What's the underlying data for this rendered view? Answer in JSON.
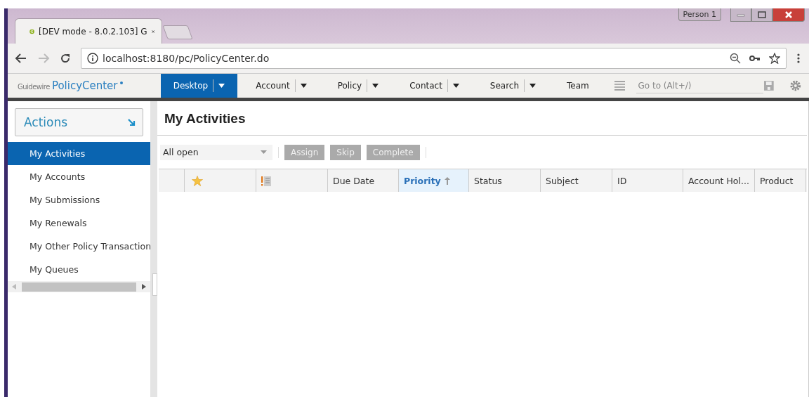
{
  "browser": {
    "tab_title": "[DEV mode - 8.0.2.103] G",
    "url": "localhost:8180/pc/PolicyCenter.do",
    "profile": "Person 1"
  },
  "app_bar": {
    "brand": "Guidewire",
    "product": "PolicyCenter",
    "nav": [
      {
        "label": "Desktop",
        "selected": true,
        "has_menu": true
      },
      {
        "label": "Account",
        "selected": false,
        "has_menu": true
      },
      {
        "label": "Policy",
        "selected": false,
        "has_menu": true
      },
      {
        "label": "Contact",
        "selected": false,
        "has_menu": true
      },
      {
        "label": "Search",
        "selected": false,
        "has_menu": true
      },
      {
        "label": "Team",
        "selected": false,
        "has_menu": false
      }
    ],
    "goto": {
      "placeholder": "Go to (Alt+/)"
    }
  },
  "sidebar": {
    "actions": "Actions",
    "items": [
      {
        "label": "My Activities",
        "selected": true
      },
      {
        "label": "My Accounts",
        "selected": false
      },
      {
        "label": "My Submissions",
        "selected": false
      },
      {
        "label": "My Renewals",
        "selected": false
      },
      {
        "label": "My Other Policy Transaction",
        "selected": false
      },
      {
        "label": "My Queues",
        "selected": false
      }
    ]
  },
  "main": {
    "title": "My Activities",
    "filter": {
      "value": "All open"
    },
    "buttons": [
      {
        "label": "Assign",
        "disabled": true
      },
      {
        "label": "Skip",
        "disabled": true
      },
      {
        "label": "Complete",
        "disabled": true
      }
    ],
    "table": {
      "columns": [
        {
          "kind": "blank",
          "sorted": false
        },
        {
          "kind": "star",
          "sorted": false
        },
        {
          "kind": "flag",
          "sorted": false
        },
        {
          "kind": "text",
          "label": "Due Date",
          "sorted": false
        },
        {
          "kind": "text",
          "label": "Priority",
          "sorted": true
        },
        {
          "kind": "text",
          "label": "Status",
          "sorted": false
        },
        {
          "kind": "text",
          "label": "Subject",
          "sorted": false
        },
        {
          "kind": "text",
          "label": "ID",
          "sorted": false
        },
        {
          "kind": "text",
          "label": "Account Hol...",
          "sorted": false
        },
        {
          "kind": "text",
          "label": "Product",
          "sorted": false
        }
      ]
    }
  }
}
